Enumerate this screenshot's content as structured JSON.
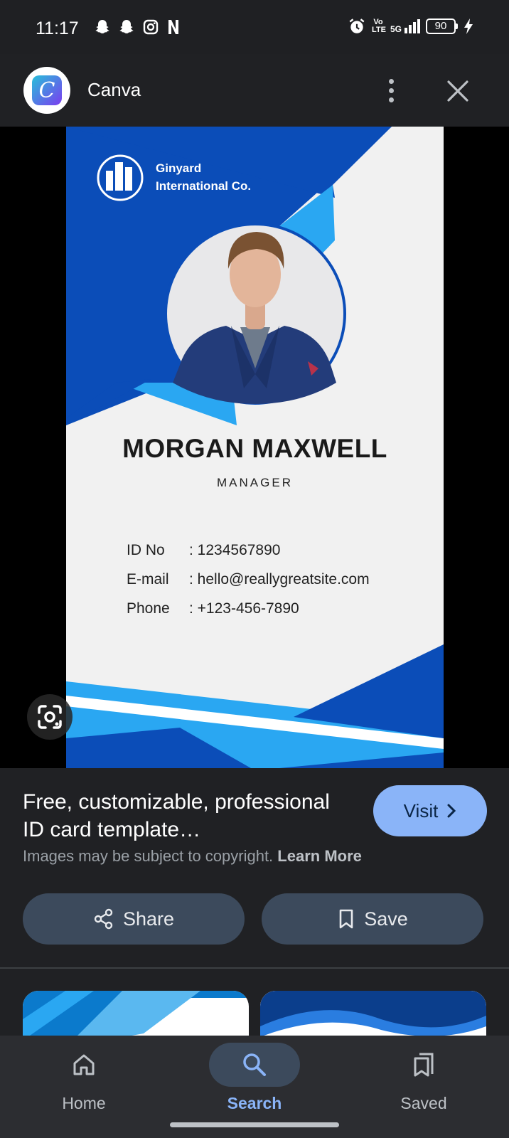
{
  "status_bar": {
    "time": "11:17",
    "left_icons": [
      "snapchat-icon",
      "snapchat-icon",
      "instagram-icon",
      "netflix-icon"
    ],
    "volte": "Vo LTE",
    "network": "5G",
    "battery": "90"
  },
  "header": {
    "app_name": "Canva",
    "logo_letter": "C"
  },
  "id_card": {
    "company_line1": "Ginyard",
    "company_line2": "International Co.",
    "name": "MORGAN MAXWELL",
    "role": "MANAGER",
    "fields": [
      {
        "label": "ID No",
        "value": ": 1234567890"
      },
      {
        "label": "E-mail",
        "value": ": hello@reallygreatsite.com"
      },
      {
        "label": "Phone",
        "value": ": +123-456-7890"
      }
    ],
    "colors": {
      "dark_blue": "#0b4db8",
      "light_blue": "#2aa7f2"
    }
  },
  "details": {
    "title": "Free, customizable, professional ID card template…",
    "copyright_text": "Images may be subject to copyright.",
    "learn_more": "Learn More",
    "visit_label": "Visit",
    "share_label": "Share",
    "save_label": "Save"
  },
  "bottom_nav": {
    "items": [
      {
        "label": "Home",
        "icon": "home-icon"
      },
      {
        "label": "Search",
        "icon": "search-icon",
        "active": true
      },
      {
        "label": "Saved",
        "icon": "saved-icon"
      }
    ]
  }
}
